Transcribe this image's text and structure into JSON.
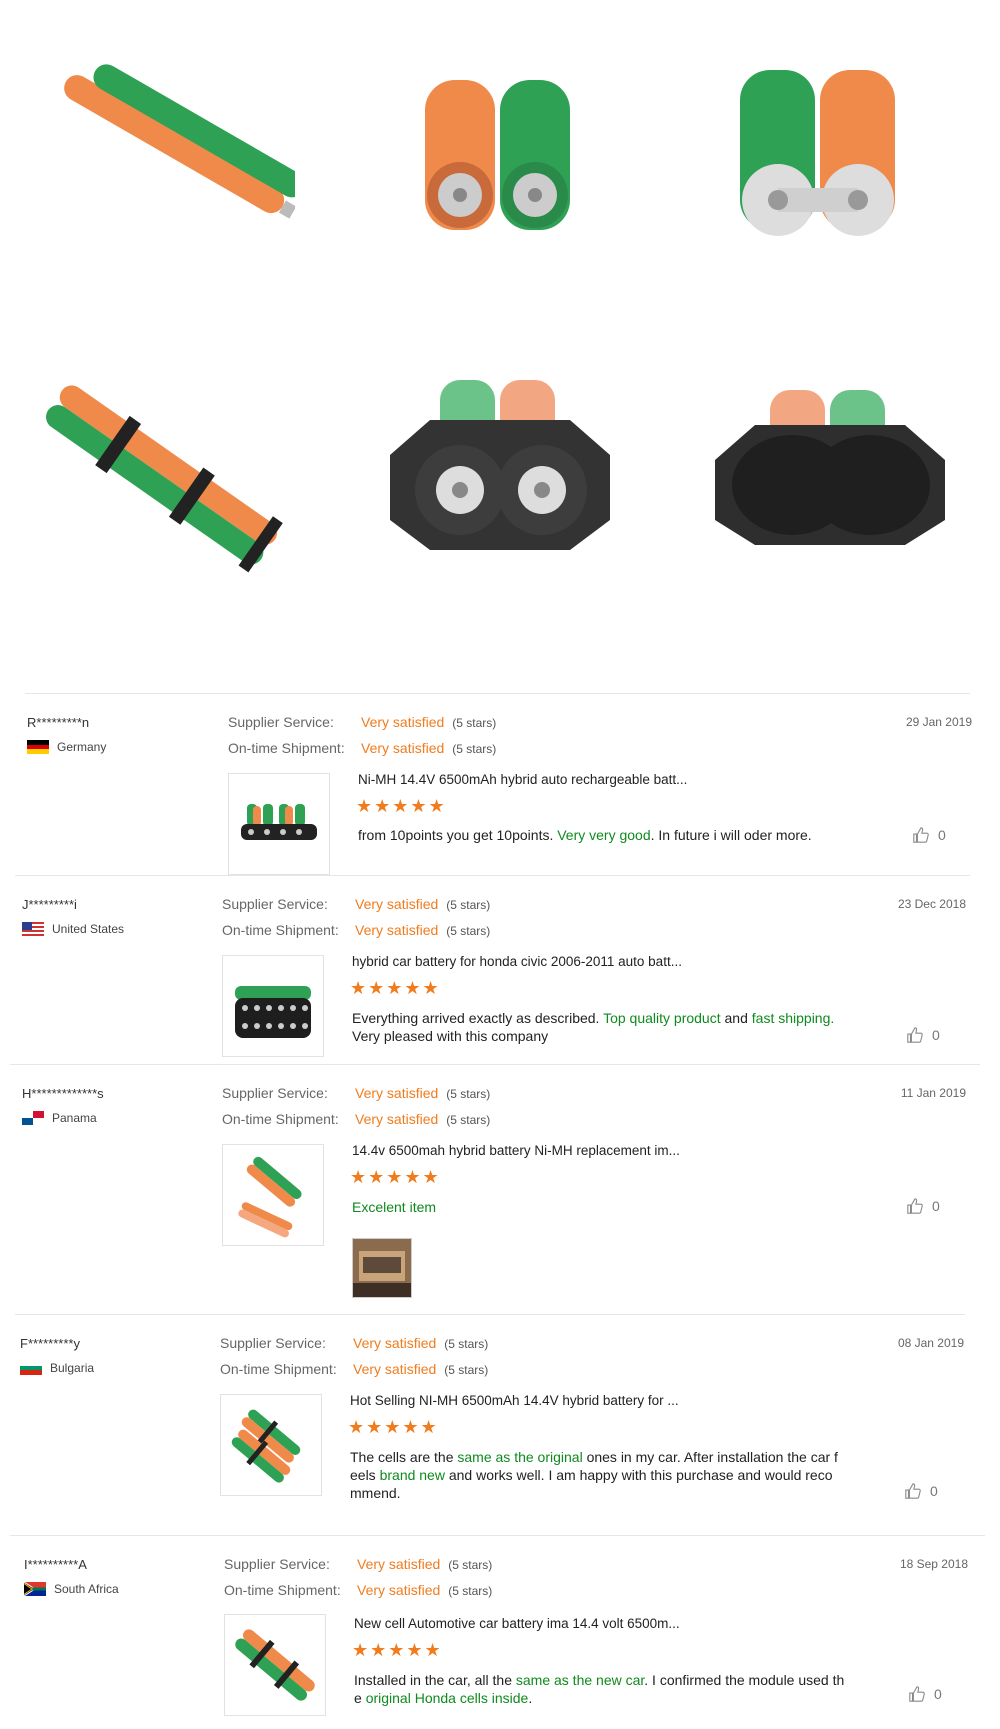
{
  "gallery": {
    "images": [
      {
        "icon": "battery-sticks-diagonal-photo"
      },
      {
        "icon": "battery-end-terminals-photo"
      },
      {
        "icon": "battery-end-connector-photo"
      },
      {
        "icon": "battery-sticks-clips-photo"
      },
      {
        "icon": "battery-holder-front-photo"
      },
      {
        "icon": "battery-holder-back-photo"
      }
    ]
  },
  "colors": {
    "accent": "#f07c1e",
    "highlight": "#0f8a1e",
    "divider": "#e6e6e6"
  },
  "labels": {
    "supplier_service": "Supplier Service:",
    "on_time_shipment": "On-time Shipment:",
    "very_satisfied": "Very satisfied",
    "five_stars": "(5 stars)",
    "stars_glyphs": "★★★★★"
  },
  "reviews": [
    {
      "user": "R*********n",
      "country": "Germany",
      "date": "29 Jan 2019",
      "product": "Ni-MH 14.4V 6500mAh hybrid auto rechargeable batt...",
      "comment_parts": [
        "from 10points you get 10points. ",
        "Very very good",
        ". In future i will oder more."
      ],
      "likes": "0"
    },
    {
      "user": "J*********i",
      "country": "United States",
      "date": "23 Dec 2018",
      "product": "hybrid car battery for honda civic 2006-2011 auto batt...",
      "comment_parts": [
        "Everything arrived exactly as described. ",
        "Top quality product",
        " and ",
        "fast shipping",
        ".",
        "Very pleased with this company"
      ],
      "likes": "0"
    },
    {
      "user": "H*************s",
      "country": "Panama",
      "date": "11 Jan 2019",
      "product": "14.4v 6500mah hybrid battery Ni-MH replacement im...",
      "comment_parts": [
        "Excelent item"
      ],
      "likes": "0"
    },
    {
      "user": "F*********y",
      "country": "Bulgaria",
      "date": "08 Jan 2019",
      "product": "Hot Selling NI-MH 6500mAh 14.4V hybrid battery for ...",
      "comment_parts": [
        "The cells are the ",
        "same as the original",
        " ones in my car. After installation the car f",
        "eels ",
        "brand new",
        " and works well. I am happy with this purchase and would reco",
        "mmend."
      ],
      "likes": "0"
    },
    {
      "user": "I**********A",
      "country": "South Africa",
      "date": "18 Sep 2018",
      "product": "New cell Automotive car battery ima 14.4 volt 6500m...",
      "comment_parts": [
        "Installed in the car, all the ",
        "same as the new car",
        ". I confirmed the module used th",
        "e ",
        "original Honda cells inside",
        "."
      ],
      "likes": "0"
    }
  ]
}
